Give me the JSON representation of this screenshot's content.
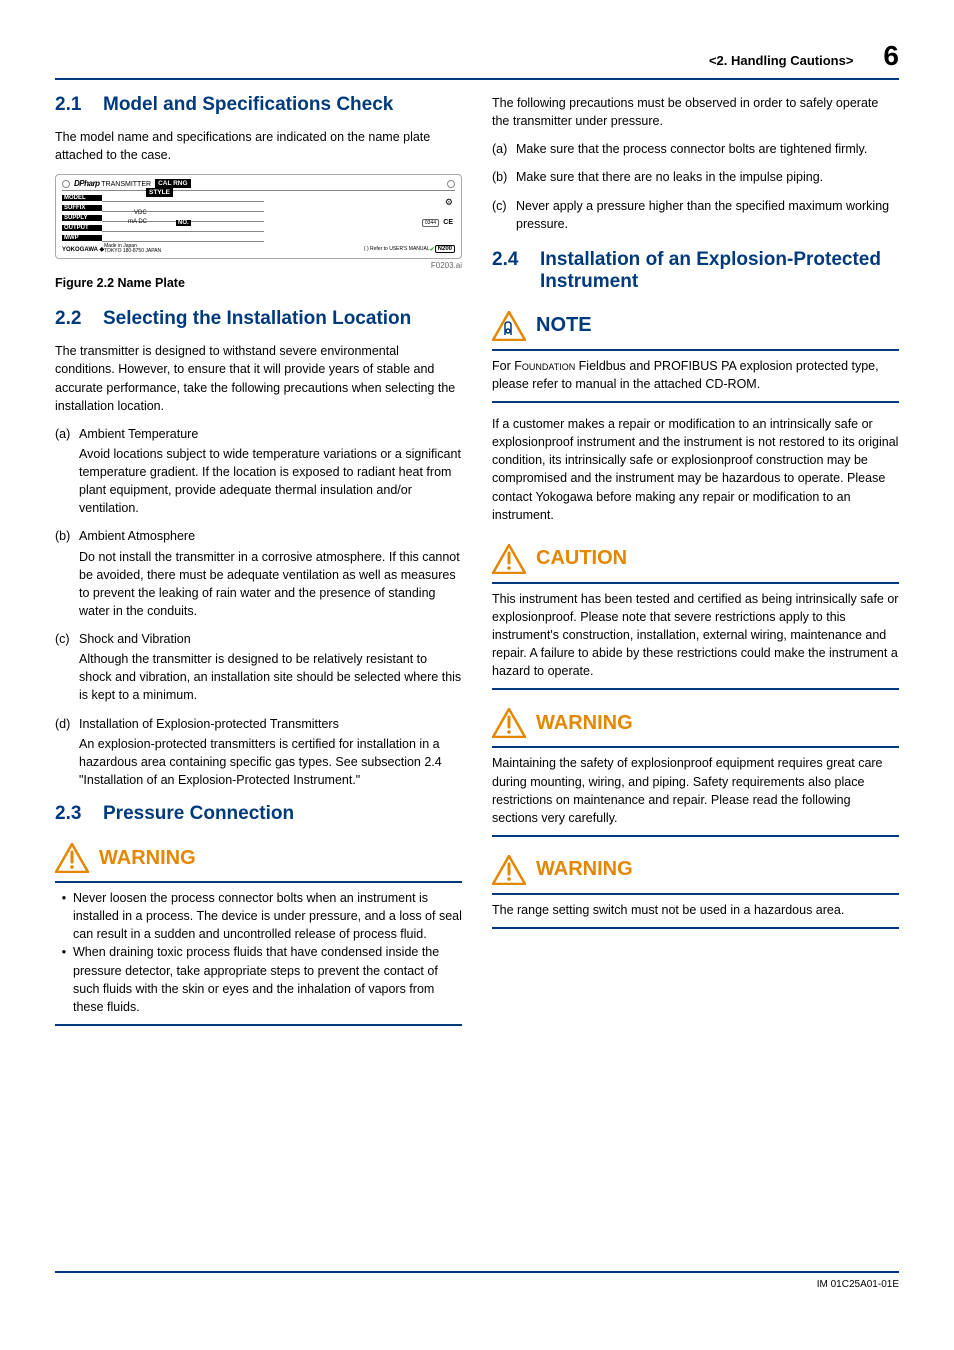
{
  "header": {
    "section": "<2.  Handling Cautions>",
    "page": "6"
  },
  "left": {
    "s21": {
      "num": "2.1",
      "title": "Model and Specifications Check",
      "p1": "The model name and specifications are indicated on the name plate attached to the case."
    },
    "nameplate": {
      "brand_bold": "DPharp",
      "brand_rest": " TRANSMITTER",
      "calrng": "CAL RNG",
      "model": "MODEL",
      "style": "STYLE",
      "suffix": "SUFFIX",
      "supply": "SUPPLY",
      "vdc": "VDC",
      "output": "OUTPUT",
      "ma": "mA DC",
      "no": "NO.",
      "mwp": "MWP",
      "maker": "YOKOGAWA ◆",
      "made": "Made in Japan",
      "addr": "TOKYO 180-8750 JAPAN",
      "refer": "(     ) Refer to USER'S MANUAL",
      "n200": "N200",
      "ce": "CE",
      "ref": "F0203.ai"
    },
    "figcap": "Figure 2.2       Name Plate",
    "s22": {
      "num": "2.2",
      "title": "Selecting the Installation Location",
      "p1": "The transmitter is designed to withstand severe environmental conditions. However, to ensure that it will provide years of stable and accurate performance, take the following precautions when selecting the installation location.",
      "a": {
        "m": "(a)",
        "t": "Ambient Temperature",
        "b": "Avoid locations subject to wide temperature variations or a significant temperature gradient. If the location is exposed to radiant heat from plant equipment, provide adequate thermal insulation and/or ventilation."
      },
      "b": {
        "m": "(b)",
        "t": "Ambient Atmosphere",
        "b": "Do not install the transmitter in a corrosive atmosphere. If this cannot be avoided, there must be adequate ventilation as well as measures to prevent the leaking of rain water and the presence of standing water in the conduits."
      },
      "c": {
        "m": "(c)",
        "t": "Shock and Vibration",
        "b": "Although the transmitter is designed to be relatively resistant to shock and vibration, an installation site should be selected where this is kept to a minimum."
      },
      "d": {
        "m": "(d)",
        "t": "Installation of Explosion-protected Transmitters",
        "b": "An explosion-protected transmitters is certified for installation in a hazardous area containing specific gas types.  See subsection 2.4 \"Installation of an Explosion-Protected Instrument.\""
      }
    },
    "s23": {
      "num": "2.3",
      "title": "Pressure Connection",
      "warn": {
        "label": "WARNING",
        "li1": "Never loosen the process connector bolts when an instrument is installed in a process.  The device is under pressure, and a loss of seal can result in a sudden and uncontrolled release of process fluid.",
        "li2": "When draining toxic process fluids that have condensed inside the pressure detector, take appropriate steps to prevent the contact of such fluids with the skin or eyes and the inhalation of vapors from these fluids."
      }
    }
  },
  "right": {
    "p1": "The following precautions must be observed in order to safely operate the transmitter under pressure.",
    "a": {
      "m": "(a)",
      "b": "Make sure that the process connector bolts are tightened firmly."
    },
    "b": {
      "m": "(b)",
      "b": "Make sure that there are no leaks in the impulse piping."
    },
    "c": {
      "m": "(c)",
      "b": "Never apply a pressure higher than the specified maximum working pressure."
    },
    "s24": {
      "num": "2.4",
      "title": "Installation of an Explosion-Protected Instrument"
    },
    "note": {
      "label": "NOTE",
      "body_pre": "For ",
      "body_sc": "Foundation",
      "body_post": " Fieldbus and PROFIBUS PA explosion protected type, please refer to manual in the attached CD-ROM."
    },
    "p2": "If a customer makes a repair or modification to an intrinsically safe or explosionproof instrument and the instrument is not restored to its original condition, its intrinsically safe or explosionproof construction may be compromised and the instrument may be hazardous to operate. Please contact Yokogawa before making any repair or modification to an instrument.",
    "caution": {
      "label": "CAUTION",
      "body": "This instrument has been tested and certified as being intrinsically safe or explosionproof. Please note that severe restrictions apply to this instrument's construction, installation, external wiring, maintenance and repair. A failure to abide by these restrictions could make the instrument a hazard to operate."
    },
    "warn1": {
      "label": "WARNING",
      "body": "Maintaining the safety of explosionproof equipment requires great care during mounting, wiring, and piping. Safety requirements also place restrictions on maintenance and repair. Please read the following sections very carefully."
    },
    "warn2": {
      "label": "WARNING",
      "body": "The range setting switch must not be used in a hazardous area."
    }
  },
  "footer": {
    "code": "IM 01C25A01-01E"
  }
}
